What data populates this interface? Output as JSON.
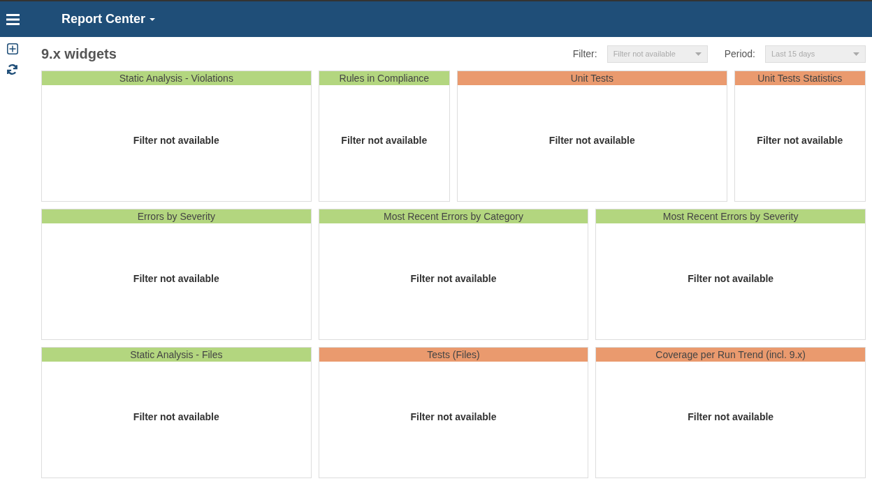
{
  "app_bar": {
    "title": "Report Center"
  },
  "page": {
    "title": "9.x widgets"
  },
  "filters": [
    {
      "label": "Filter:",
      "value": "Filter not available",
      "disabled": true
    },
    {
      "label": "Period:",
      "value": "Last 15 days",
      "disabled": true
    }
  ],
  "widgets": [
    {
      "title": "Static Analysis - Violations",
      "color": "#b3d67f",
      "kind": "wide",
      "message": "Filter not available"
    },
    {
      "title": "Rules in Compliance",
      "color": "#b3d67f",
      "kind": "narrow",
      "message": "Filter not available"
    },
    {
      "title": "Unit Tests",
      "color": "#ea9a6e",
      "kind": "wide",
      "message": "Filter not available"
    },
    {
      "title": "Unit Tests Statistics",
      "color": "#ea9a6e",
      "kind": "narrow",
      "message": "Filter not available"
    },
    {
      "title": "Errors by Severity",
      "color": "#b3d67f",
      "kind": "wide",
      "message": "Filter not available"
    },
    {
      "title": "Most Recent Errors by Category",
      "color": "#b3d67f",
      "kind": "wide",
      "message": "Filter not available"
    },
    {
      "title": "Most Recent Errors by Severity",
      "color": "#b3d67f",
      "kind": "wide",
      "message": "Filter not available"
    },
    {
      "title": "Static Analysis - Files",
      "color": "#b3d67f",
      "kind": "wide",
      "message": "Filter not available"
    },
    {
      "title": "Tests (Files)",
      "color": "#ea9a6e",
      "kind": "wide",
      "message": "Filter not available"
    },
    {
      "title": "Coverage per Run Trend (incl. 9.x)",
      "color": "#ea9a6e",
      "kind": "wide",
      "message": "Filter not available"
    }
  ]
}
